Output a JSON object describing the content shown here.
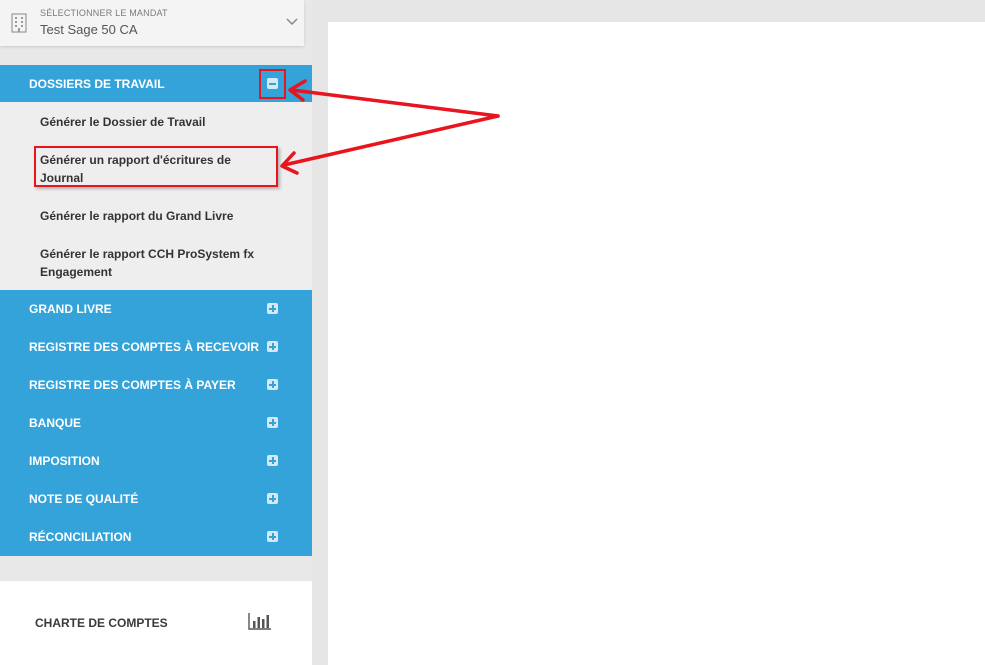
{
  "mandat": {
    "label": "SÉLECTIONNER LE MANDAT",
    "value": "Test Sage 50 CA"
  },
  "menu": {
    "expanded": {
      "title": "DOSSIERS DE TRAVAIL",
      "items": [
        "Générer le Dossier de Travail",
        "Générer un rapport d'écritures de Journal",
        "Générer le rapport du Grand Livre",
        "Générer le rapport CCH ProSystem fx Engagement"
      ]
    },
    "sections": [
      "GRAND LIVRE",
      "REGISTRE DES COMPTES À RECEVOIR",
      "REGISTRE DES COMPTES À PAYER",
      "BANQUE",
      "IMPOSITION",
      "NOTE DE QUALITÉ",
      "RÉCONCILIATION"
    ]
  },
  "chart": {
    "label": "CHARTE DE COMPTES",
    "icon": "bar-chart-icon"
  },
  "colors": {
    "accent": "#34a3da",
    "annotation": "#e8141e"
  }
}
